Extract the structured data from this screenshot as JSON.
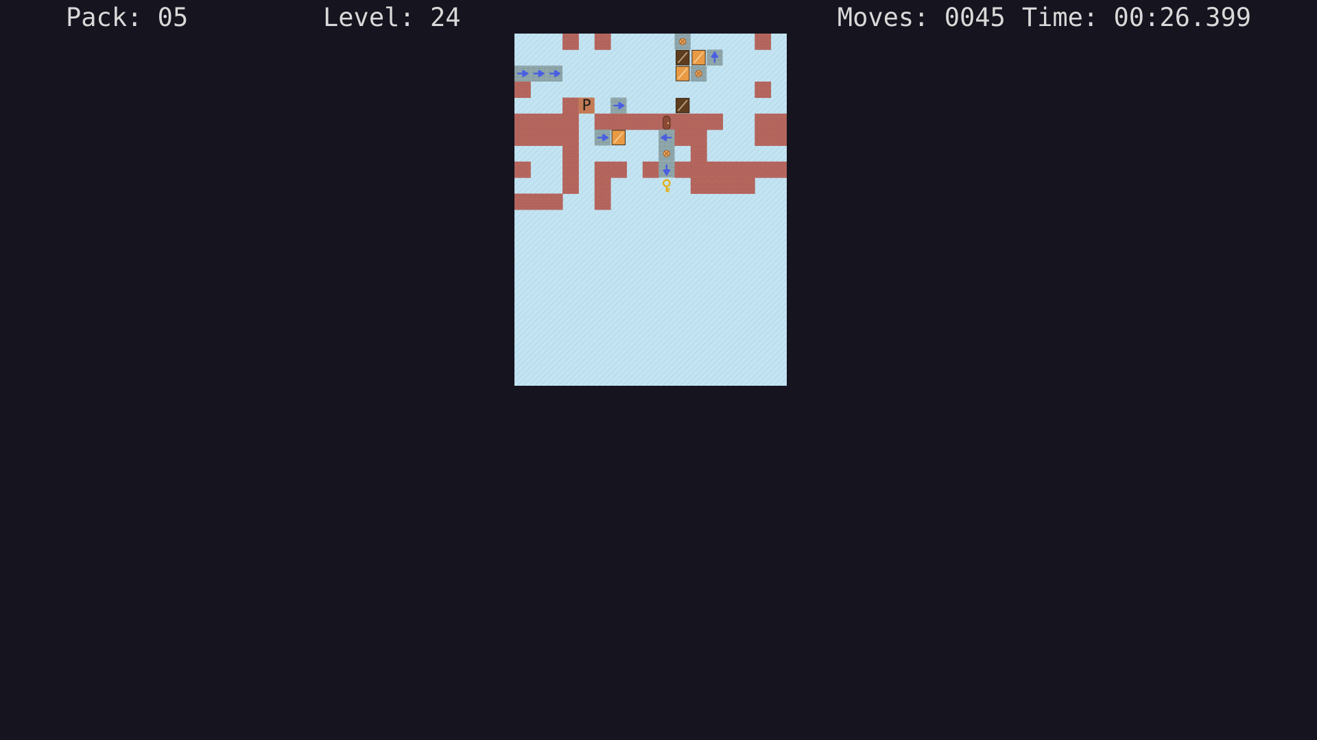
{
  "hud": {
    "pack_label": "Pack:",
    "pack_value": "05",
    "level_label": "Level:",
    "level_value": "24",
    "moves_label": "Moves:",
    "moves_value": "0045",
    "time_label": "Time:",
    "time_value": "00:26.399"
  },
  "colors": {
    "background": "#15141f",
    "hud_text": "#d9d9d9",
    "ice": "#c4e4f2",
    "ice_stripe": "#a6d1e6",
    "wall": "#b5675e",
    "wall_mortar": "#9c544c",
    "conveyor": "#8fa7ab",
    "conveyor_arrow": "#4a5fe0",
    "crate_light": "#e89a44",
    "crate_dark": "#5e3c1e",
    "player_tile": "#c47a55",
    "key": "#e0b020"
  },
  "board": {
    "columns": 17,
    "rows": 11,
    "grid": [
      "...W.W....v....W..",
      "..........KC^.....",
      "RRR.......cv.....",
      "W..............W.W",
      "...WP.R...K......",
      "WWWW.WWWWDWWW..WWW",
      "WWWW.RC..LWW...WWW",
      "...W.....v.W......",
      "W..W.WW.WdWWWWWWWW",
      "...W.W...k.WWWW...",
      "WWW..W..........."
    ],
    "legend": {
      ".": "ice",
      "W": "wall",
      "R": "conveyor-right",
      "L": "conveyor-left",
      "^": "conveyor-up",
      "d": "conveyor-down",
      "v": "conveyor-target",
      "c": "crate-light-vertical",
      "C": "crate-light",
      "K": "crate-dark",
      "D": "door",
      "P": "player",
      "k": "key"
    },
    "player_label": "P"
  }
}
